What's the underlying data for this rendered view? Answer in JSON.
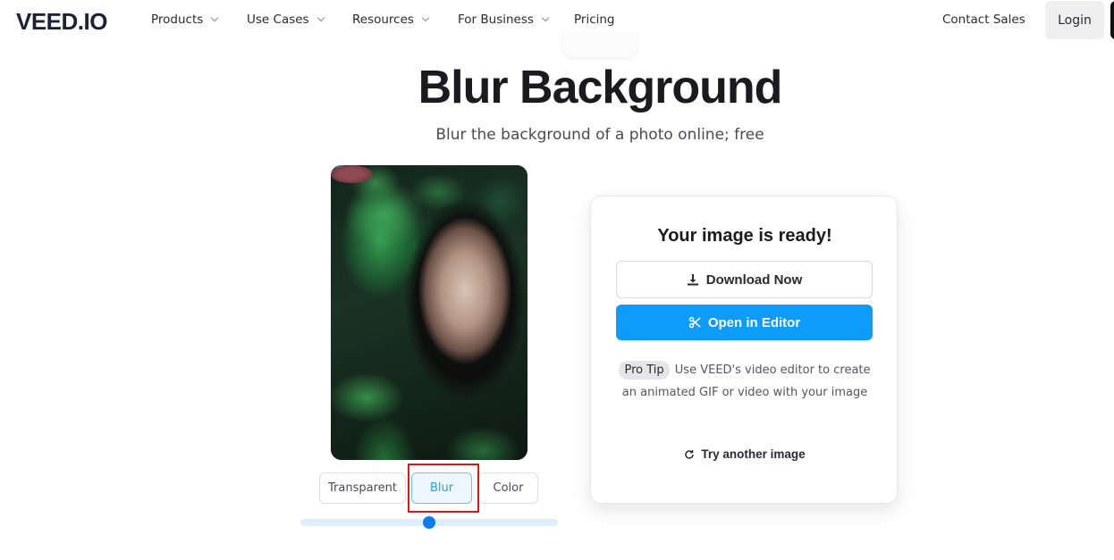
{
  "nav": {
    "logo": "VEED.IO",
    "items": [
      {
        "label": "Products",
        "has_dropdown": true
      },
      {
        "label": "Use Cases",
        "has_dropdown": true
      },
      {
        "label": "Resources",
        "has_dropdown": true
      },
      {
        "label": "For Business",
        "has_dropdown": true
      },
      {
        "label": "Pricing",
        "has_dropdown": false
      }
    ],
    "contact_sales": "Contact Sales",
    "login": "Login"
  },
  "hero": {
    "title": "Blur Background",
    "subtitle": "Blur the background of a photo online; free"
  },
  "preview": {
    "image_alt": "Portrait of a woman with dark hair behind green leaves, background blurred",
    "modes": [
      {
        "label": "Transparent",
        "selected": false
      },
      {
        "label": "Blur",
        "selected": true
      },
      {
        "label": "Color",
        "selected": false
      }
    ],
    "blur_amount_fraction": 0.5
  },
  "result_card": {
    "title": "Your image is ready!",
    "download_label": "Download Now",
    "editor_label": "Open in Editor",
    "tip_badge": "Pro Tip",
    "tip_text": "Use VEED's video editor to create an animated GIF or video with your image",
    "try_another_label": "Try another image"
  },
  "colors": {
    "accent": "#0d9cfa",
    "selected_mode_text": "#1ba1ef",
    "slider_thumb": "#0a7bf0",
    "highlight": "#e01515"
  }
}
